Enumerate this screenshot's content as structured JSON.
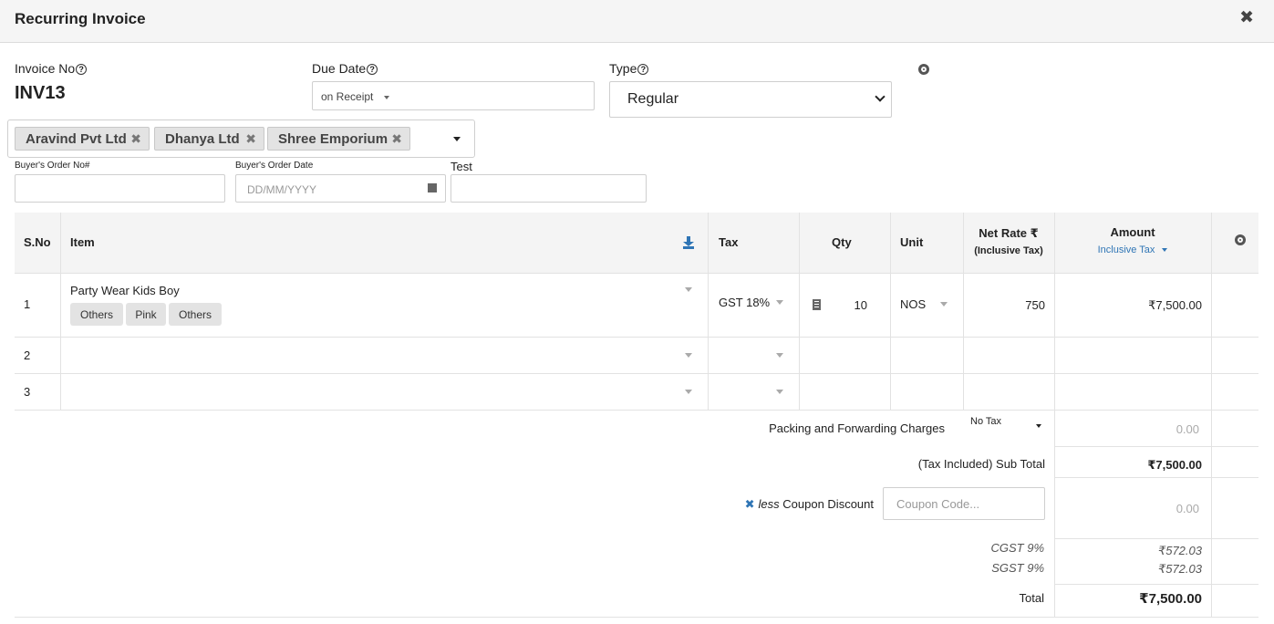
{
  "header": {
    "title": "Recurring Invoice"
  },
  "invoice": {
    "label": "Invoice No",
    "value": "INV13"
  },
  "due_date": {
    "label": "Due Date",
    "value": "on Receipt"
  },
  "type": {
    "label": "Type",
    "value": "Regular"
  },
  "buyers": [
    "Aravind Pvt Ltd",
    "Dhanya Ltd",
    "Shree Emporium"
  ],
  "fields": {
    "order_no_label": "Buyer's Order No#",
    "order_date_label": "Buyer's Order Date",
    "order_date_placeholder": "DD/MM/YYYY",
    "test_label": "Test"
  },
  "table": {
    "headers": {
      "sno": "S.No",
      "item": "Item",
      "tax": "Tax",
      "qty": "Qty",
      "unit": "Unit",
      "net_rate": "Net Rate ₹",
      "net_rate_sub": "(Inclusive Tax)",
      "amount": "Amount",
      "amount_sub": "Inclusive Tax"
    },
    "rows": [
      {
        "sno": "1",
        "item": "Party Wear Kids Boy",
        "attributes": [
          "Others",
          "Pink",
          "Others"
        ],
        "tax": "GST 18%",
        "qty": "10",
        "unit": "NOS",
        "rate": "750",
        "amount": "₹7,500.00"
      },
      {
        "sno": "2"
      },
      {
        "sno": "3"
      }
    ]
  },
  "totals": {
    "packing_label": "Packing and Forwarding Charges",
    "packing_tax": "No Tax",
    "packing_value": "0.00",
    "subtotal_label": "(Tax Included) Sub Total",
    "subtotal_value": "₹7,500.00",
    "coupon_less": "less",
    "coupon_label": "Coupon Discount",
    "coupon_placeholder": "Coupon Code...",
    "coupon_value": "0.00",
    "cgst_label": "CGST 9%",
    "cgst_value": "₹572.03",
    "sgst_label": "SGST 9%",
    "sgst_value": "₹572.03",
    "total_label": "Total",
    "total_value": "₹7,500.00"
  }
}
